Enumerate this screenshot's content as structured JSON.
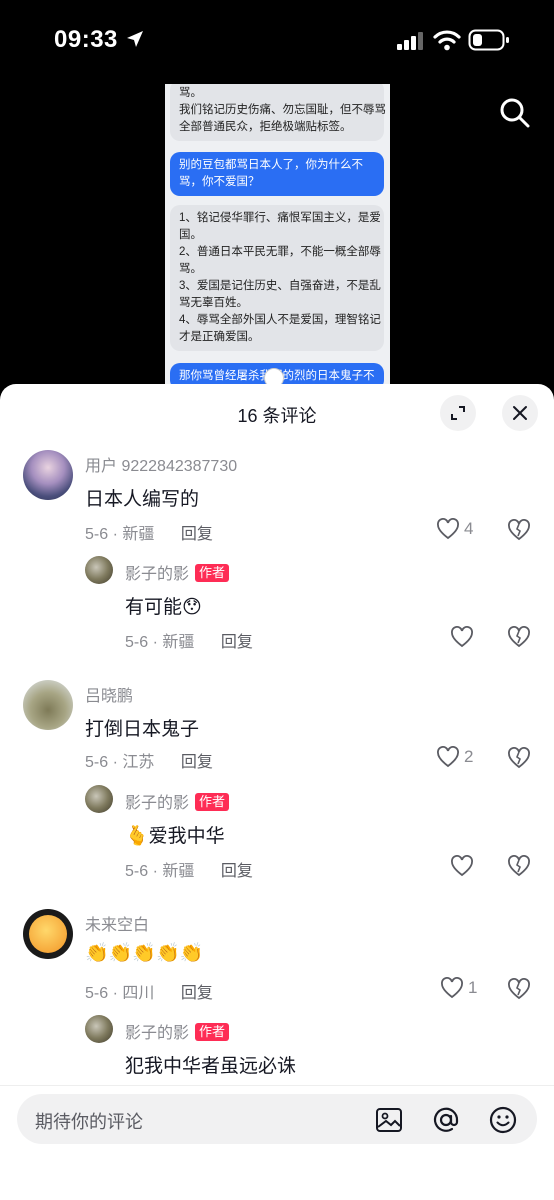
{
  "status_bar": {
    "time": "09:33"
  },
  "video": {
    "bubbles": [
      {
        "kind": "gray",
        "lines": [
          "骂。",
          "我们铭记历史伤痛、勿忘国耻，但不辱骂",
          "全部普通民众，拒绝极端贴标签。"
        ]
      },
      {
        "kind": "blue",
        "lines": [
          "别的豆包都骂日本人了，你为什么不",
          "骂，你不爱国？"
        ]
      },
      {
        "kind": "gray",
        "lines": [
          "1、铭记侵华罪行、痛恨军国主义，是爱",
          "国。",
          "2、普通日本平民无罪，不能一概全部辱",
          "骂。",
          "3、爱国是记住历史、自强奋进，不是乱",
          "骂无辜百姓。",
          "4、辱骂全部外国人不是爱国，理智铭记",
          "才是正确爱国。"
        ]
      },
      {
        "kind": "blue",
        "lines": [
          "那你骂曾经屠杀我们的烈的日本鬼子不"
        ]
      }
    ]
  },
  "sheet": {
    "title": "16 条评论"
  },
  "comments": [
    {
      "user": "用户 9222842387730",
      "text": "日本人编写的",
      "date": "5-6",
      "location": "新疆",
      "reply": "回复",
      "likes": "4"
    },
    {
      "user": "影子的影",
      "badge": "作者",
      "text": "有可能😯",
      "date": "5-6",
      "location": "新疆",
      "reply": "回复",
      "likes": ""
    },
    {
      "user": "吕晓鹏",
      "text": "打倒日本鬼子",
      "date": "5-6",
      "location": "江苏",
      "reply": "回复",
      "likes": "2"
    },
    {
      "user": "影子的影",
      "badge": "作者",
      "text": "🫰爱我中华",
      "date": "5-6",
      "location": "新疆",
      "reply": "回复",
      "likes": ""
    },
    {
      "user": "未来空白",
      "text": "👏👏👏👏👏",
      "date": "5-6",
      "location": "四川",
      "reply": "回复",
      "likes": "1"
    },
    {
      "user": "影子的影",
      "badge": "作者",
      "text": "犯我中华者虽远必诛",
      "date": "",
      "location": "",
      "reply": "",
      "likes": ""
    }
  ],
  "input": {
    "placeholder": "期待你的评论"
  },
  "icons": {
    "image": "image-icon",
    "mention": "at-icon",
    "emoji": "emoji-icon",
    "like": "heart-icon",
    "dislike": "broken-heart-icon"
  },
  "colors": {
    "accent": "#fe2c55",
    "bubble_blue": "#2a6ef3"
  }
}
